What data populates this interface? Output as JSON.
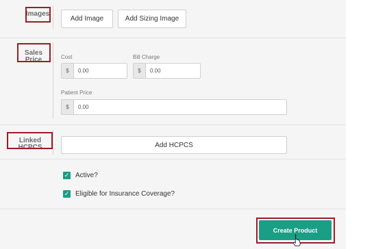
{
  "sections": {
    "images": {
      "label": "Images",
      "add_image": "Add Image",
      "add_sizing_image": "Add Sizing Image"
    },
    "sales_price": {
      "label": "Sales Price",
      "cost": {
        "label": "Cost",
        "prefix": "$",
        "value": "0.00"
      },
      "bill_charge": {
        "label": "Bill Charge",
        "prefix": "$",
        "value": "0.00"
      },
      "patient_price": {
        "label": "Patient Price",
        "prefix": "$",
        "value": "0.00"
      }
    },
    "linked_hcpcs": {
      "label": "Linked HCPCS",
      "add_hcpcs": "Add HCPCS"
    },
    "options": {
      "active": {
        "label": "Active?",
        "checked": true
      },
      "eligible": {
        "label": "Eligible for Insurance Coverage?",
        "checked": true
      }
    }
  },
  "footer": {
    "create_product": "Create Product"
  },
  "colors": {
    "accent": "#1a9e86",
    "highlight": "#9b1c24"
  },
  "icons": {
    "checkmark": "checkmark-icon",
    "cursor": "hand-pointer-cursor-icon"
  }
}
